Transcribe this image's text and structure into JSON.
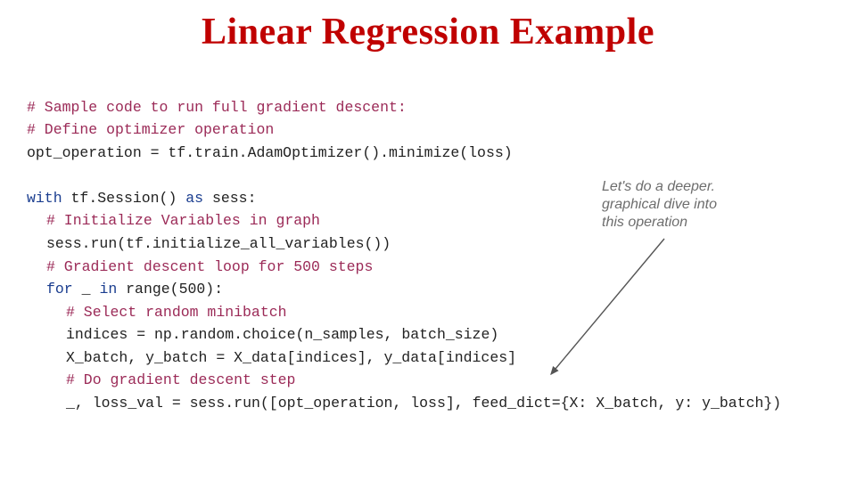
{
  "title": "Linear Regression Example",
  "code": {
    "l1_comment": "# Sample code to run full gradient descent:",
    "l2_comment": "# Define optimizer operation",
    "l3_a": "opt_operation ",
    "l3_b": "=",
    "l3_c": " tf",
    "l3_d": ".",
    "l3_e": "train",
    "l3_f": ".",
    "l3_g": "AdamOptimizer",
    "l3_h": "().",
    "l3_i": "minimize",
    "l3_j": "(",
    "l3_k": "loss",
    "l3_l": ")",
    "l5_with": "with",
    "l5_a": " tf",
    "l5_b": ".",
    "l5_c": "Session",
    "l5_d": "() ",
    "l5_as": "as",
    "l5_e": " sess",
    "l5_f": ":",
    "l6_comment": "# Initialize Variables in graph",
    "l7_a": "sess",
    "l7_b": ".",
    "l7_c": "run",
    "l7_d": "(",
    "l7_e": "tf",
    "l7_f": ".",
    "l7_g": "initialize_all_variables",
    "l7_h": "())",
    "l8_comment": "# Gradient descent loop for 500 steps",
    "l9_for": "for",
    "l9_a": " _ ",
    "l9_in": "in",
    "l9_b": " range",
    "l9_c": "(",
    "l9_d": "500",
    "l9_e": "):",
    "l10_comment": "# Select random minibatch",
    "l11_a": "indices ",
    "l11_b": "=",
    "l11_c": " np",
    "l11_d": ".",
    "l11_e": "random",
    "l11_f": ".",
    "l11_g": "choice",
    "l11_h": "(",
    "l11_i": "n_samples",
    "l11_j": ", ",
    "l11_k": "batch_size",
    "l11_l": ")",
    "l12_a": "X_batch",
    "l12_b": ", ",
    "l12_c": "y_batch ",
    "l12_d": "=",
    "l12_e": " X_data",
    "l12_f": "[",
    "l12_g": "indices",
    "l12_h": "], ",
    "l12_i": "y_data",
    "l12_j": "[",
    "l12_k": "indices",
    "l12_l": "]",
    "l13_comment": "# Do gradient descent step",
    "l14_a": "_",
    "l14_b": ", ",
    "l14_c": "loss_val ",
    "l14_d": "=",
    "l14_e": " sess",
    "l14_f": ".",
    "l14_g": "run",
    "l14_h": "([",
    "l14_i": "opt_operation",
    "l14_j": ", ",
    "l14_k": "loss",
    "l14_l": "], ",
    "l14_m": "feed_dict",
    "l14_n": "={",
    "l14_o": "X",
    "l14_p": ": ",
    "l14_q": "X_batch",
    "l14_r": ", ",
    "l14_s": "y",
    "l14_t": ": ",
    "l14_u": "y_batch",
    "l14_v": "})"
  },
  "annotation": {
    "line1": "Let's do a deeper.",
    "line2": "graphical dive into",
    "line3": "this operation"
  }
}
